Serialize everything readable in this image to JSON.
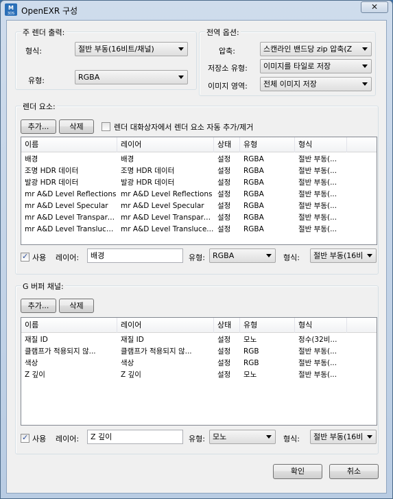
{
  "window": {
    "title": "OpenEXR 구성",
    "app_icon_text": "3DS"
  },
  "main_output": {
    "title": "주 렌더 출력:",
    "format_label": "형식:",
    "format_value": "절반 부동(16비트/채널)",
    "type_label": "유형:",
    "type_value": "RGBA"
  },
  "global_options": {
    "title": "전역 옵션:",
    "compression_label": "압축:",
    "compression_value": "스캔라인 밴드당 zip 압축(Z",
    "storage_label": "저장소 유형:",
    "storage_value": "이미지를 타일로 저장",
    "region_label": "이미지 영역:",
    "region_value": "전체 이미지 저장"
  },
  "render_elements": {
    "title": "렌더 요소:",
    "add_label": "추가...",
    "delete_label": "삭제",
    "auto_checkbox_label": "렌더 대화상자에서 렌더 요소 자동 추가/제거",
    "columns": [
      "이름",
      "레이어",
      "상태",
      "유형",
      "형식"
    ],
    "rows": [
      [
        "배경",
        "배경",
        "설정",
        "RGBA",
        "절반 부동(..."
      ],
      [
        "조명 HDR 데이터",
        "조명 HDR 데이터",
        "설정",
        "RGBA",
        "절반 부동(..."
      ],
      [
        "발광 HDR 데이터",
        "발광 HDR 데이터",
        "설정",
        "RGBA",
        "절반 부동(..."
      ],
      [
        "mr A&D Level Reflections",
        "mr A&D Level Reflections",
        "설정",
        "RGBA",
        "절반 부동(..."
      ],
      [
        "mr A&D Level Specular",
        "mr A&D Level Specular",
        "설정",
        "RGBA",
        "절반 부동(..."
      ],
      [
        "mr A&D Level Transpare...",
        "mr A&D Level Transpare...",
        "설정",
        "RGBA",
        "절반 부동(..."
      ],
      [
        "mr A&D Level Translucency",
        "mr A&D Level Transluce...",
        "설정",
        "RGBA",
        "절반 부동(..."
      ]
    ],
    "use_label": "사용",
    "layer_label": "레이어:",
    "layer_value": "배경",
    "type_label": "유형:",
    "type_value": "RGBA",
    "format_label": "형식:",
    "format_value": "절반 부동(16비"
  },
  "gbuffer": {
    "title": "G 버퍼 채널:",
    "add_label": "추가...",
    "delete_label": "삭제",
    "columns": [
      "이름",
      "레이어",
      "상태",
      "유형",
      "형식"
    ],
    "rows": [
      [
        "재질 ID",
        "재질 ID",
        "설정",
        "모노",
        "정수(32비..."
      ],
      [
        "클램프가 적용되지 않...",
        "클램프가 적용되지 않...",
        "설정",
        "RGB",
        "절반 부동(..."
      ],
      [
        "색상",
        "색상",
        "설정",
        "RGB",
        "절반 부동(..."
      ],
      [
        "Z 깊이",
        "Z 깊이",
        "설정",
        "모노",
        "절반 부동(..."
      ]
    ],
    "use_label": "사용",
    "layer_label": "레이어:",
    "layer_value": "Z 깊이",
    "type_label": "유형:",
    "type_value": "모노",
    "format_label": "형식:",
    "format_value": "절반 부동(16비"
  },
  "footer": {
    "ok_label": "확인",
    "cancel_label": "취소"
  }
}
